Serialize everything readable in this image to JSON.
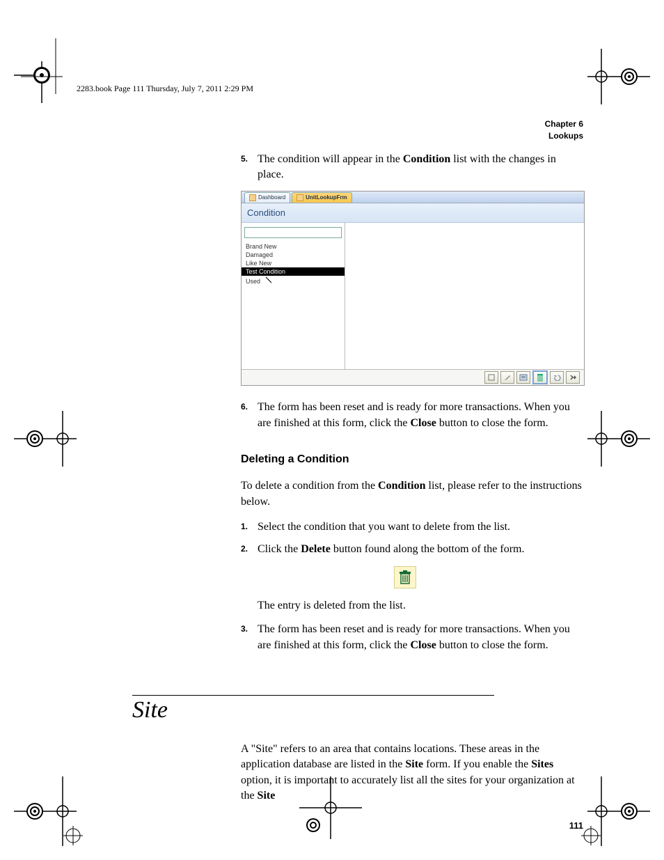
{
  "header": {
    "running_head": "2283.book  Page 111  Thursday, July 7, 2011  2:29 PM"
  },
  "chapter": {
    "label": "Chapter 6",
    "title": "Lookups"
  },
  "steps_a": [
    {
      "num": "5.",
      "pre": "The condition will appear in the ",
      "bold": "Condition",
      "post": " list with the changes in place."
    }
  ],
  "screenshot": {
    "tab_inactive": "Dashboard",
    "tab_active": "UnitLookupFrm",
    "title": "Condition",
    "items": [
      "Brand New",
      "Damaged",
      "Like New",
      "Test Condition",
      "Used"
    ],
    "selected_index": 3,
    "toolbar": [
      "new",
      "edit",
      "view",
      "delete",
      "undo",
      "close"
    ]
  },
  "steps_b": [
    {
      "num": "6.",
      "text_parts": [
        "The form has been reset and is ready for more transactions. When you are finished at this form, click the ",
        "Close",
        " button to close the form."
      ]
    }
  ],
  "subheading": "Deleting a Condition",
  "delete_intro_parts": [
    "To delete a condition from the ",
    "Condition",
    " list, please refer to the instructions below."
  ],
  "delete_steps": [
    {
      "num": "1.",
      "text": "Select the condition that you want to delete from the list."
    },
    {
      "num": "2.",
      "pre": "Click the ",
      "bold": "Delete",
      "post": " button found along the bottom of the form."
    }
  ],
  "delete_result": "The entry is deleted from the list.",
  "delete_steps_2": [
    {
      "num": "3.",
      "text_parts": [
        "The form has been reset and is ready for more transactions. When you are finished at this form, click the ",
        "Close",
        " button to close the form."
      ]
    }
  ],
  "section_title": "Site",
  "site_paragraph_parts": [
    "A \"Site\" refers to an area that contains locations. These areas in the application database are listed in the ",
    "Site",
    " form. If you enable the ",
    "Sites",
    " option, it is important to accurately list all the sites for your organization at the ",
    "Site"
  ],
  "page_number": "111"
}
